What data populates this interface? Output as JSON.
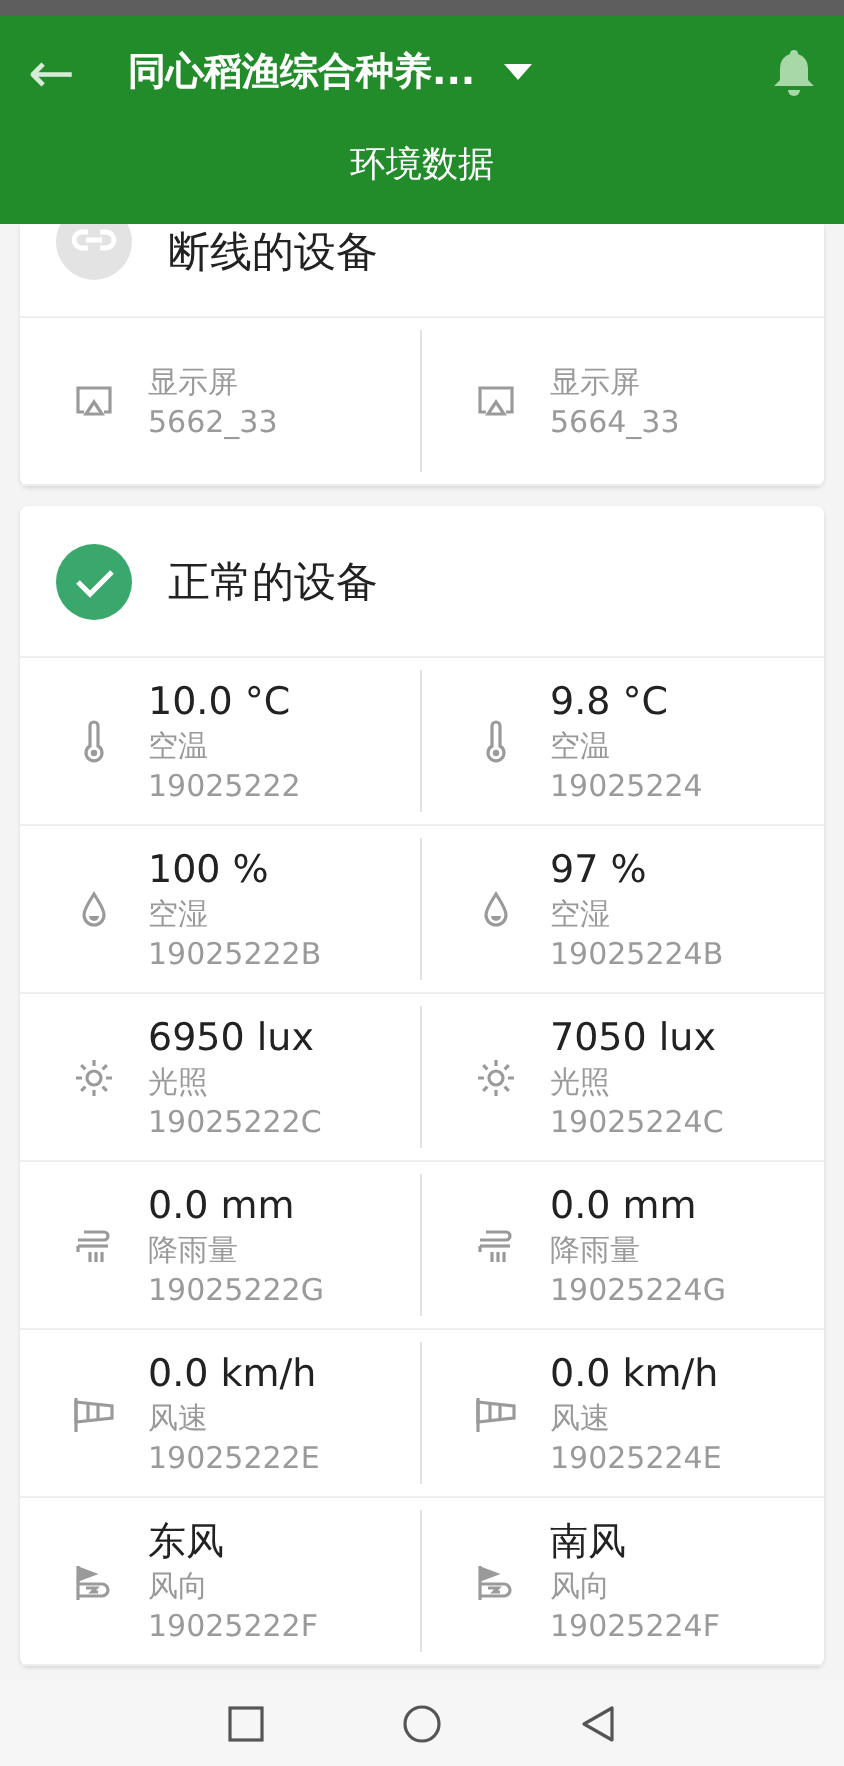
{
  "header": {
    "back": "←",
    "title": "同心稻渔综合种养...",
    "subtitle": "环境数据"
  },
  "sections": [
    {
      "kind": "offline",
      "title": "断线的设备",
      "devices": [
        {
          "kind": "screen",
          "name": "显示屏",
          "id": "5662_33"
        },
        {
          "kind": "screen",
          "name": "显示屏",
          "id": "5664_33"
        }
      ]
    },
    {
      "kind": "ok",
      "title": "正常的设备",
      "devices": [
        {
          "kind": "thermometer",
          "value": "10.0 °C",
          "name": "空温",
          "id": "19025222"
        },
        {
          "kind": "thermometer",
          "value": "9.8 °C",
          "name": "空温",
          "id": "19025224"
        },
        {
          "kind": "drop",
          "value": "100 %",
          "name": "空湿",
          "id": "19025222B"
        },
        {
          "kind": "drop",
          "value": "97 %",
          "name": "空湿",
          "id": "19025224B"
        },
        {
          "kind": "sun",
          "value": "6950 lux",
          "name": "光照",
          "id": "19025222C"
        },
        {
          "kind": "sun",
          "value": "7050 lux",
          "name": "光照",
          "id": "19025224C"
        },
        {
          "kind": "rain",
          "value": "0.0 mm",
          "name": "降雨量",
          "id": "19025222G"
        },
        {
          "kind": "rain",
          "value": "0.0 mm",
          "name": "降雨量",
          "id": "19025224G"
        },
        {
          "kind": "windsock",
          "value": "0.0 km/h",
          "name": "风速",
          "id": "19025222E"
        },
        {
          "kind": "windsock",
          "value": "0.0 km/h",
          "name": "风速",
          "id": "19025224E"
        },
        {
          "kind": "flag",
          "value": "东风",
          "name": "风向",
          "id": "19025222F"
        },
        {
          "kind": "flag",
          "value": "南风",
          "name": "风向",
          "id": "19025224F"
        }
      ]
    }
  ]
}
